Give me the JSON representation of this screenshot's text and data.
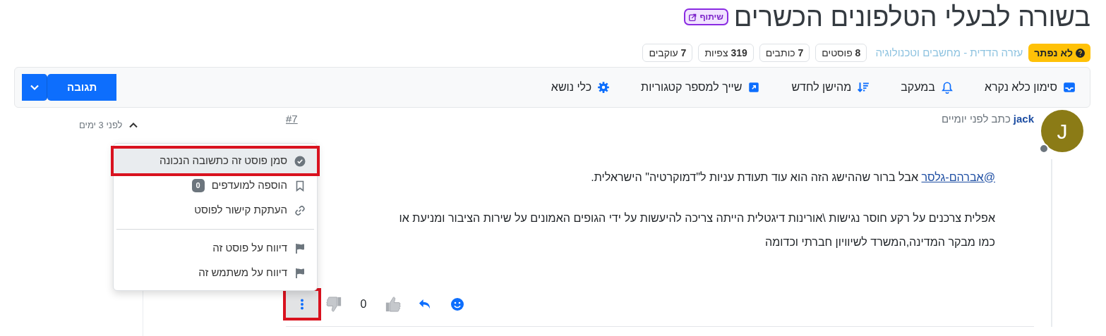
{
  "title": {
    "text": "בשורה לבעלי הטלפונים הכשרים",
    "share_badge": "שיתוף"
  },
  "meta": {
    "status": "לא נפתר",
    "category": "עזרה הדדית - מחשבים וטכנולוגיה",
    "stats": [
      "**8** פוסטים",
      "**7** כותבים",
      "**319** צפיות",
      "**7** עוקבים"
    ]
  },
  "toolbar": {
    "items": [
      "סימון כלא נקרא",
      "במעקב",
      "מהישן לחדש",
      "שייך למספר קטגוריות",
      "כלי נושא"
    ],
    "reply_button": "תגובה"
  },
  "post": {
    "avatar_letter": "J",
    "author": "jack",
    "wrote": "כתב לפני יומיים",
    "index": "#7",
    "side_time": "לפני 3 ימים",
    "mention": "@אברהם-גלסר",
    "first_line": " אבל ברור שההישג הזה הוא עוד תעודת עניות ל\"דמוקרטיה\" הישראלית.",
    "lines": [
      "אפלית צרכנים על רקע חוסר נגישות \\אורינות דיגטלית הייתה צריכה להיעשות על ידי הגופים האמונים על שירות הציבור ומניעת או",
      "כמו מבקר המדינה,המשרד לשיוויון חברתי וכדומה"
    ],
    "votes": "0",
    "more_button": {
      "active": true,
      "annotated": true
    }
  },
  "menu": {
    "groups": [
      [
        {
          "label": "סמן פוסט זה כתשובה הנכונה",
          "active": true,
          "annotated": true
        },
        {
          "label": "הוספה למועדפים",
          "badge": "0",
          "active": false,
          "annotated": false
        },
        {
          "label": "העתקת קישור לפוסט",
          "active": false,
          "annotated": false
        }
      ],
      [
        {
          "label": "דיווח על פוסט זה",
          "active": false,
          "annotated": false
        },
        {
          "label": "דיווח על משתמש זה",
          "active": false,
          "annotated": false
        }
      ]
    ]
  }
}
